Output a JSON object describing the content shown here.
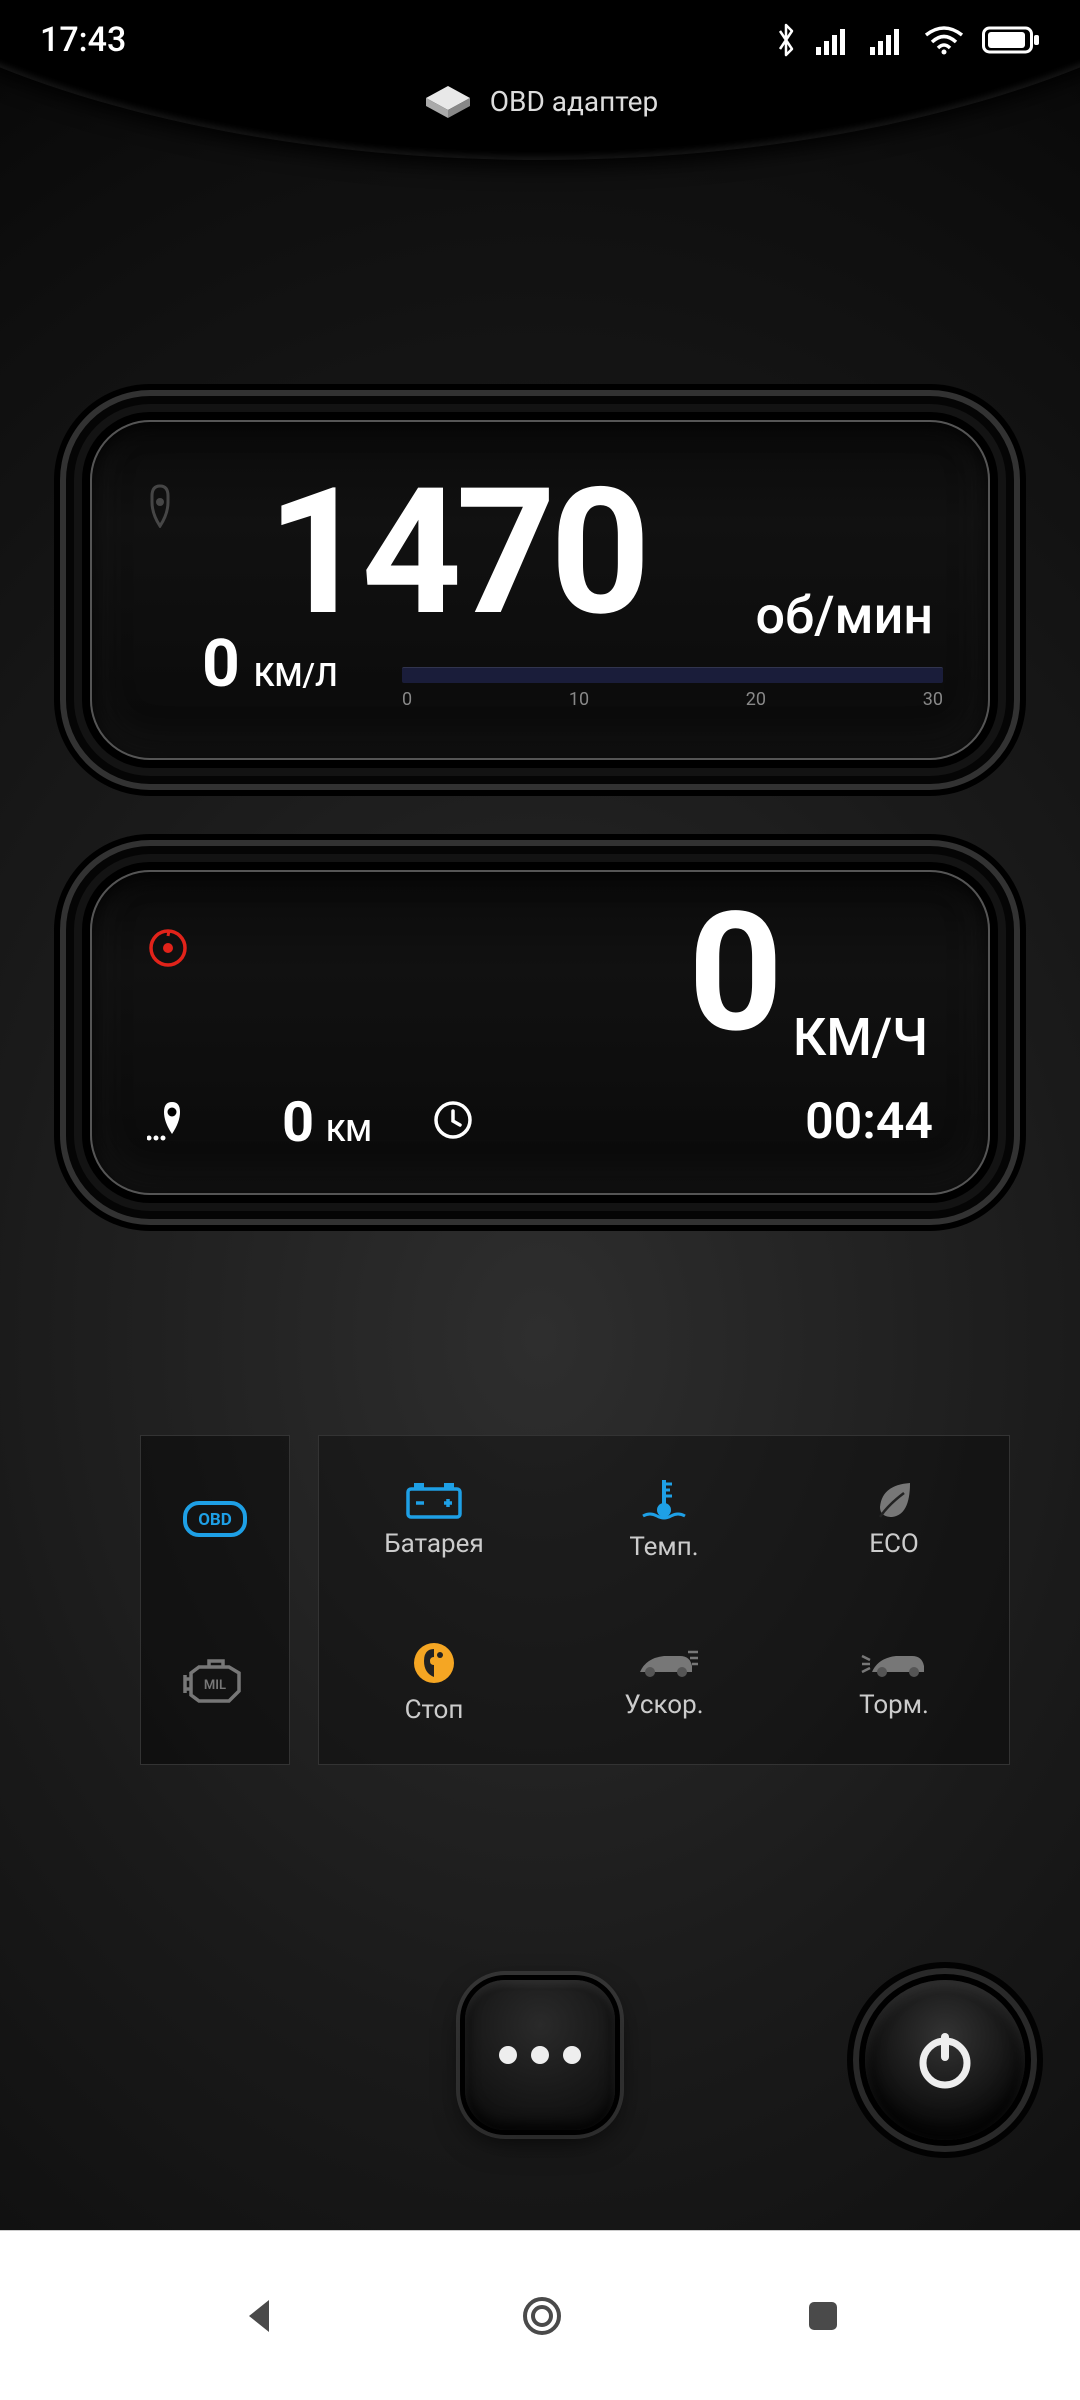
{
  "status": {
    "time": "17:43"
  },
  "header": {
    "label": "OBD адаптер"
  },
  "gauge_rpm": {
    "value": "1470",
    "unit": "об/мин",
    "fuel_value": "0",
    "fuel_unit": "КМ/Л",
    "scale": [
      "0",
      "10",
      "20",
      "30"
    ]
  },
  "gauge_speed": {
    "value": "0",
    "unit": "КМ/Ч",
    "distance_value": "0",
    "distance_unit": "КМ",
    "time": "00:44"
  },
  "grid": {
    "side": {
      "obd": "OBD",
      "mil": "MIL"
    },
    "battery": "Батарея",
    "temp": "Темп.",
    "eco": "ECO",
    "stop": "Стоп",
    "accel": "Ускор.",
    "brake": "Торм."
  }
}
